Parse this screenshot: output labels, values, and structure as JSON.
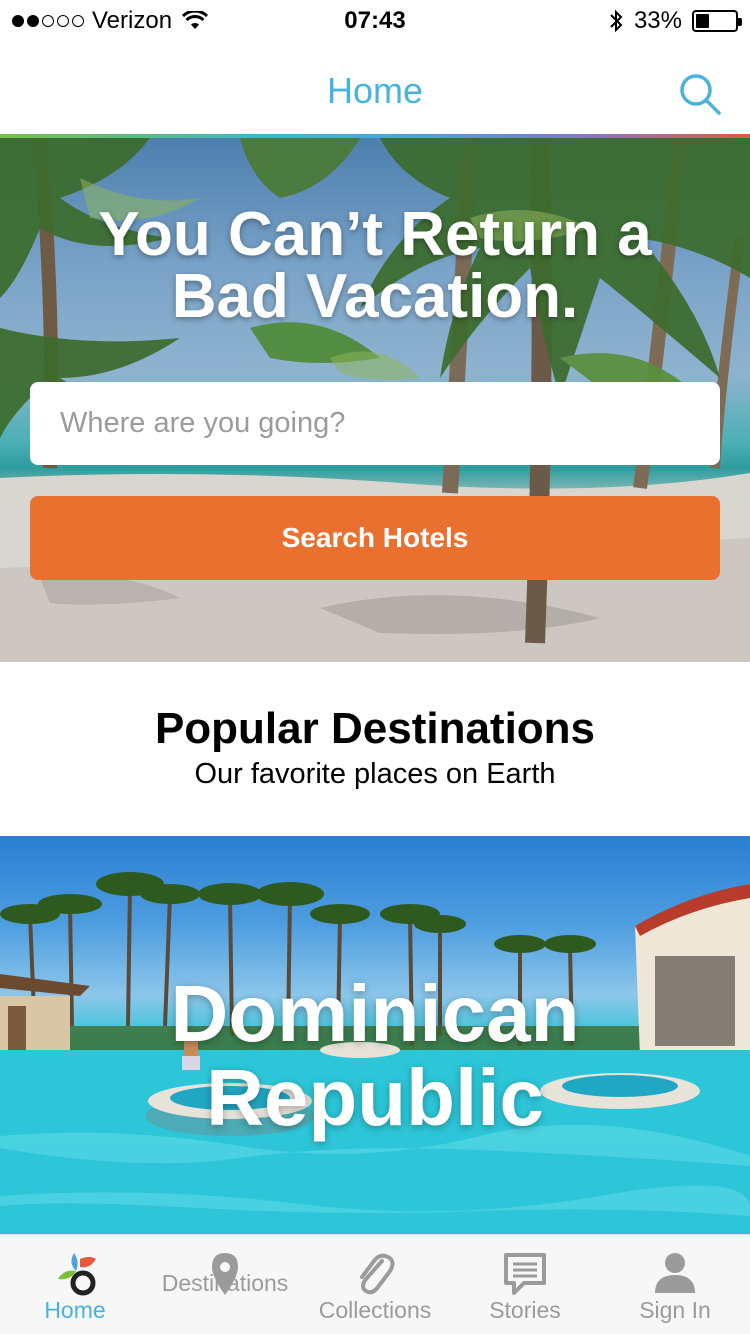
{
  "status_bar": {
    "carrier": "Verizon",
    "time": "07:43",
    "battery_percent": "33%",
    "battery_level": 0.33,
    "signal_bars_filled": 2,
    "signal_bars_total": 5
  },
  "nav": {
    "title": "Home",
    "search_icon": "search-icon"
  },
  "hero": {
    "title_line1": "You Can’t Return a",
    "title_line2": "Bad Vacation.",
    "search_placeholder": "Where are you going?",
    "search_button_label": "Search Hotels"
  },
  "popular": {
    "title": "Popular Destinations",
    "subtitle": "Our favorite places on Earth"
  },
  "destination_card": {
    "title_line1": "Dominican",
    "title_line2": "Republic"
  },
  "tabs": [
    {
      "label": "Home",
      "icon": "logo-icon",
      "active": true
    },
    {
      "label": "Destinations",
      "icon": "map-pin-icon",
      "active": false
    },
    {
      "label": "Collections",
      "icon": "paperclip-icon",
      "active": false
    },
    {
      "label": "Stories",
      "icon": "chat-bubble-icon",
      "active": false
    },
    {
      "label": "Sign In",
      "icon": "person-icon",
      "active": false
    }
  ],
  "colors": {
    "accent_blue": "#4ab3dd",
    "button_orange": "#e9702f",
    "inactive_gray": "#9b9b9b"
  }
}
